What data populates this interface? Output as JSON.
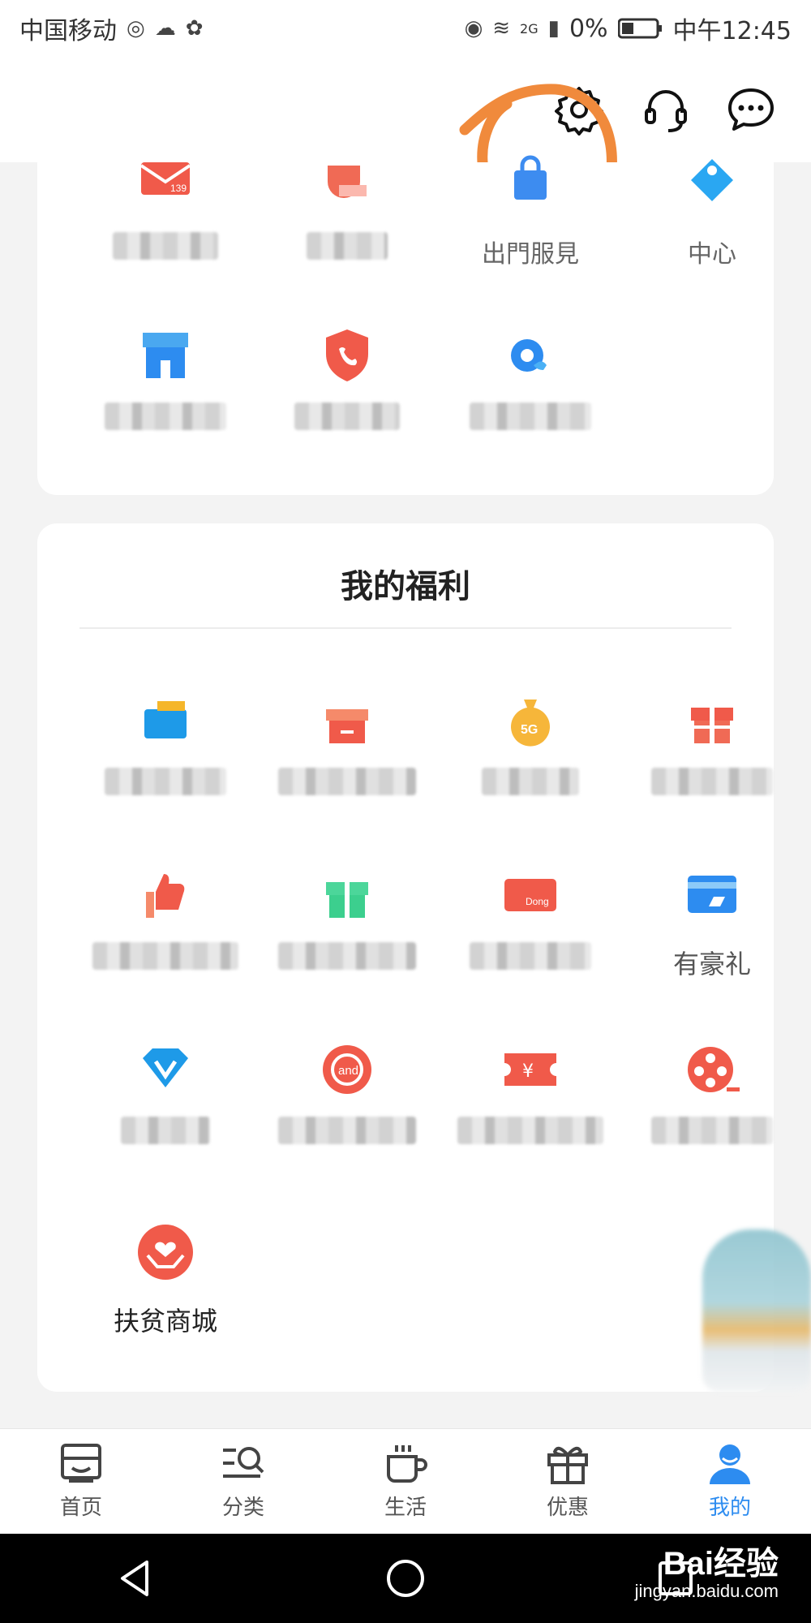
{
  "status_bar": {
    "carrier": "中国移动",
    "network_tag": "2G",
    "battery_pct": "0%",
    "time": "中午12:45"
  },
  "header": {
    "icons": [
      "settings-icon",
      "customer-service-icon",
      "message-icon"
    ]
  },
  "top_section": {
    "row1": [
      {
        "icon": "mail-139-icon",
        "label": ""
      },
      {
        "icon": "cup-icon",
        "label": ""
      },
      {
        "icon": "bag-icon",
        "label": "出門服見"
      },
      {
        "icon": "puzzle-icon",
        "label": "中心"
      }
    ],
    "row2": [
      {
        "icon": "store-icon",
        "label": ""
      },
      {
        "icon": "shield-phone-icon",
        "label": ""
      },
      {
        "icon": "gear-phone-icon",
        "label": ""
      }
    ]
  },
  "welfare": {
    "title": "我的福利",
    "items": [
      {
        "icon": "wallet-icon",
        "label": ""
      },
      {
        "icon": "gift-box-icon",
        "label": ""
      },
      {
        "icon": "5g-money-bag-icon",
        "label": ""
      },
      {
        "icon": "red-gift-icon",
        "label": ""
      },
      {
        "icon": "thumbs-up-icon",
        "label": ""
      },
      {
        "icon": "green-gift-icon",
        "label": ""
      },
      {
        "icon": "dong-card-icon",
        "label": ""
      },
      {
        "icon": "bank-card-icon",
        "label": "有豪礼"
      },
      {
        "icon": "diamond-icon",
        "label": ""
      },
      {
        "icon": "and-logo-icon",
        "label": ""
      },
      {
        "icon": "yuan-ticket-icon",
        "label": ""
      },
      {
        "icon": "film-reel-icon",
        "label": ""
      },
      {
        "icon": "poverty-aid-icon",
        "label": "扶贫商城"
      }
    ]
  },
  "tabbar": {
    "tabs": [
      {
        "label": "首页",
        "icon": "home-icon"
      },
      {
        "label": "分类",
        "icon": "category-icon"
      },
      {
        "label": "生活",
        "icon": "coffee-icon"
      },
      {
        "label": "优惠",
        "icon": "gift-icon"
      },
      {
        "label": "我的",
        "icon": "profile-icon",
        "active": true
      }
    ]
  },
  "watermark": {
    "brand": "Bai经验",
    "url": "jingyan.baidu.com"
  },
  "colors": {
    "accent_blue": "#2d8cf0",
    "annotation_orange": "#f08a3c",
    "icon_red": "#f05a4a"
  }
}
